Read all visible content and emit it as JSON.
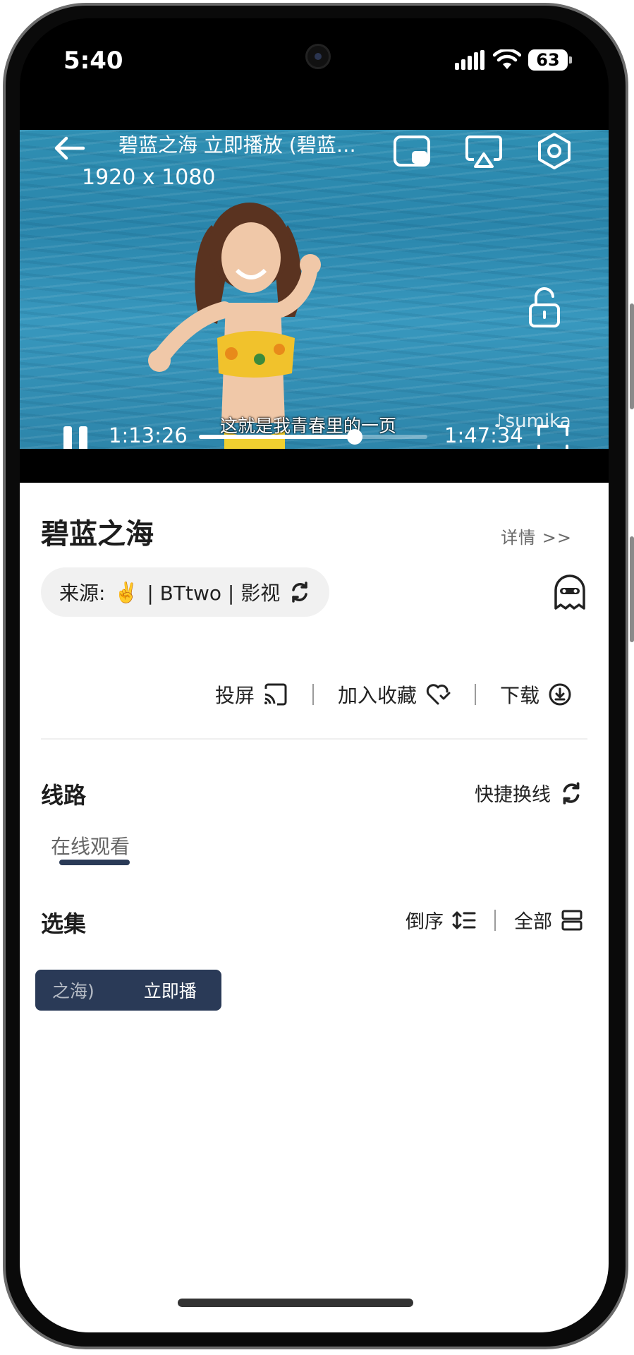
{
  "status_bar": {
    "time": "5:40",
    "battery": "63",
    "signal_icon": "signal-bars-icon",
    "wifi_icon": "wifi-icon"
  },
  "player": {
    "title": "碧蓝之海 立即播放 (碧蓝之海)",
    "resolution": "1920 x 1080",
    "subtitle": "这就是我青春里的一页",
    "watermark": "♪sumika",
    "current_time": "1:13:26",
    "total_time": "1:47:34",
    "progress": 0.683,
    "icons": [
      "back-arrow-icon",
      "picture-in-picture-icon",
      "airplay-icon",
      "settings-hexagon-icon",
      "unlock-icon",
      "pause-icon",
      "fullscreen-icon"
    ]
  },
  "detail": {
    "title": "碧蓝之海",
    "detail_link": "详情 >>",
    "source_label": "来源:",
    "source_emoji": "✌️",
    "source_text": "| BTtwo | 影视",
    "actions": {
      "cast": "投屏",
      "favorite": "加入收藏",
      "download": "下载"
    }
  },
  "lines": {
    "heading": "线路",
    "quick_switch": "快捷换线",
    "tab": "在线观看"
  },
  "episodes": {
    "heading": "选集",
    "reverse": "倒序",
    "all": "全部",
    "item_part_a": "之海)",
    "item_part_b": "立即播"
  },
  "colors": {
    "accent": "#2a3a57",
    "sea": "#2f8fb3"
  }
}
